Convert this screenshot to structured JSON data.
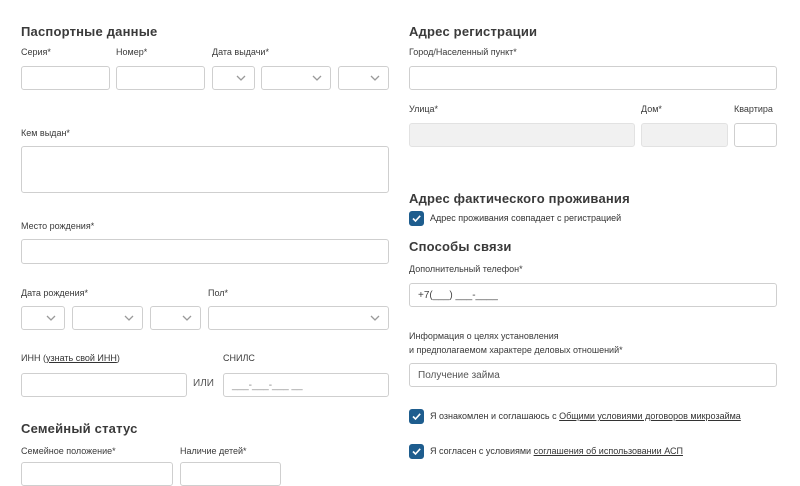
{
  "passport": {
    "title": "Паспортные данные",
    "series_label": "Серия*",
    "number_label": "Номер*",
    "issue_date_label": "Дата выдачи*",
    "issued_by_label": "Кем выдан*",
    "birthplace_label": "Место рождения*",
    "birthdate_label": "Дата рождения*",
    "gender_label": "Пол*",
    "inn_label": "ИНН",
    "inn_link": "узнать свой ИНН",
    "or_text": "ИЛИ",
    "snils_label": "СНИЛС",
    "snils_placeholder": "___-___-___ __"
  },
  "family": {
    "title": "Семейный статус",
    "marital_label": "Семейное положение*",
    "children_label": "Наличие детей*"
  },
  "registration": {
    "title": "Адрес регистрации",
    "city_label": "Город/Населенный пункт*",
    "street_label": "Улица*",
    "house_label": "Дом*",
    "apartment_label": "Квартира"
  },
  "actual_address": {
    "title": "Адрес фактического проживания",
    "same_checkbox_label": "Адрес проживания совпадает с регистрацией",
    "same_checked": true
  },
  "contacts": {
    "title": "Способы связи",
    "phone_label": "Дополнительный телефон*",
    "phone_value": "+7(___) ___-____",
    "purpose_label_line1": "Информация о целях установления",
    "purpose_label_line2": "и предполагаемом характере деловых отношений*",
    "purpose_value": "Получение займа"
  },
  "agreements": {
    "terms_prefix": "Я ознакомлен и соглашаюсь с ",
    "terms_link": "Общими условиями договоров микрозайма",
    "terms_checked": true,
    "asp_prefix": "Я согласен с условиями ",
    "asp_link": "соглашения об использовании АСП",
    "asp_checked": true
  },
  "colors": {
    "accent": "#1e5d8e",
    "border": "#cfcfcf",
    "disabled_bg": "#f1f1f1"
  }
}
